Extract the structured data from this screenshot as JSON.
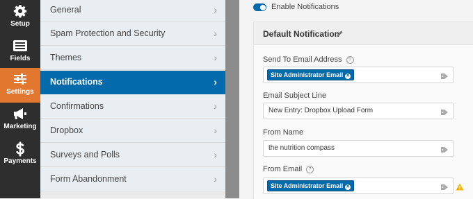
{
  "nav": [
    {
      "label": "Setup",
      "icon": "gear-icon",
      "active": false
    },
    {
      "label": "Fields",
      "icon": "fields-list-icon",
      "active": false
    },
    {
      "label": "Settings",
      "icon": "sliders-icon",
      "active": true
    },
    {
      "label": "Marketing",
      "icon": "megaphone-icon",
      "active": false
    },
    {
      "label": "Payments",
      "icon": "dollar-icon",
      "active": false
    }
  ],
  "settings_panel": {
    "items": [
      {
        "label": "General"
      },
      {
        "label": "Spam Protection and Security"
      },
      {
        "label": "Themes"
      },
      {
        "label": "Notifications",
        "active": true
      },
      {
        "label": "Confirmations"
      },
      {
        "label": "Dropbox"
      },
      {
        "label": "Surveys and Polls"
      },
      {
        "label": "Form Abandonment"
      }
    ],
    "chevron": "›"
  },
  "content": {
    "enable_notifications": {
      "label": "Enable Notifications",
      "checked": true
    },
    "notification": {
      "title": "Default Notification",
      "fields": {
        "send_to": {
          "label": "Send To Email Address",
          "chip": "Site Administrator Email"
        },
        "subject": {
          "label": "Email Subject Line",
          "value": "New Entry: Dropbox Upload Form"
        },
        "from_name": {
          "label": "From Name",
          "value": "the nutrition compass"
        },
        "from_email": {
          "label": "From Email",
          "chip": "Site Administrator Email"
        }
      }
    }
  },
  "colors": {
    "accent_blue": "#036aab",
    "settings_orange": "#e27730",
    "nav_dark": "#2e2e2e",
    "warning": "#f0b400"
  }
}
